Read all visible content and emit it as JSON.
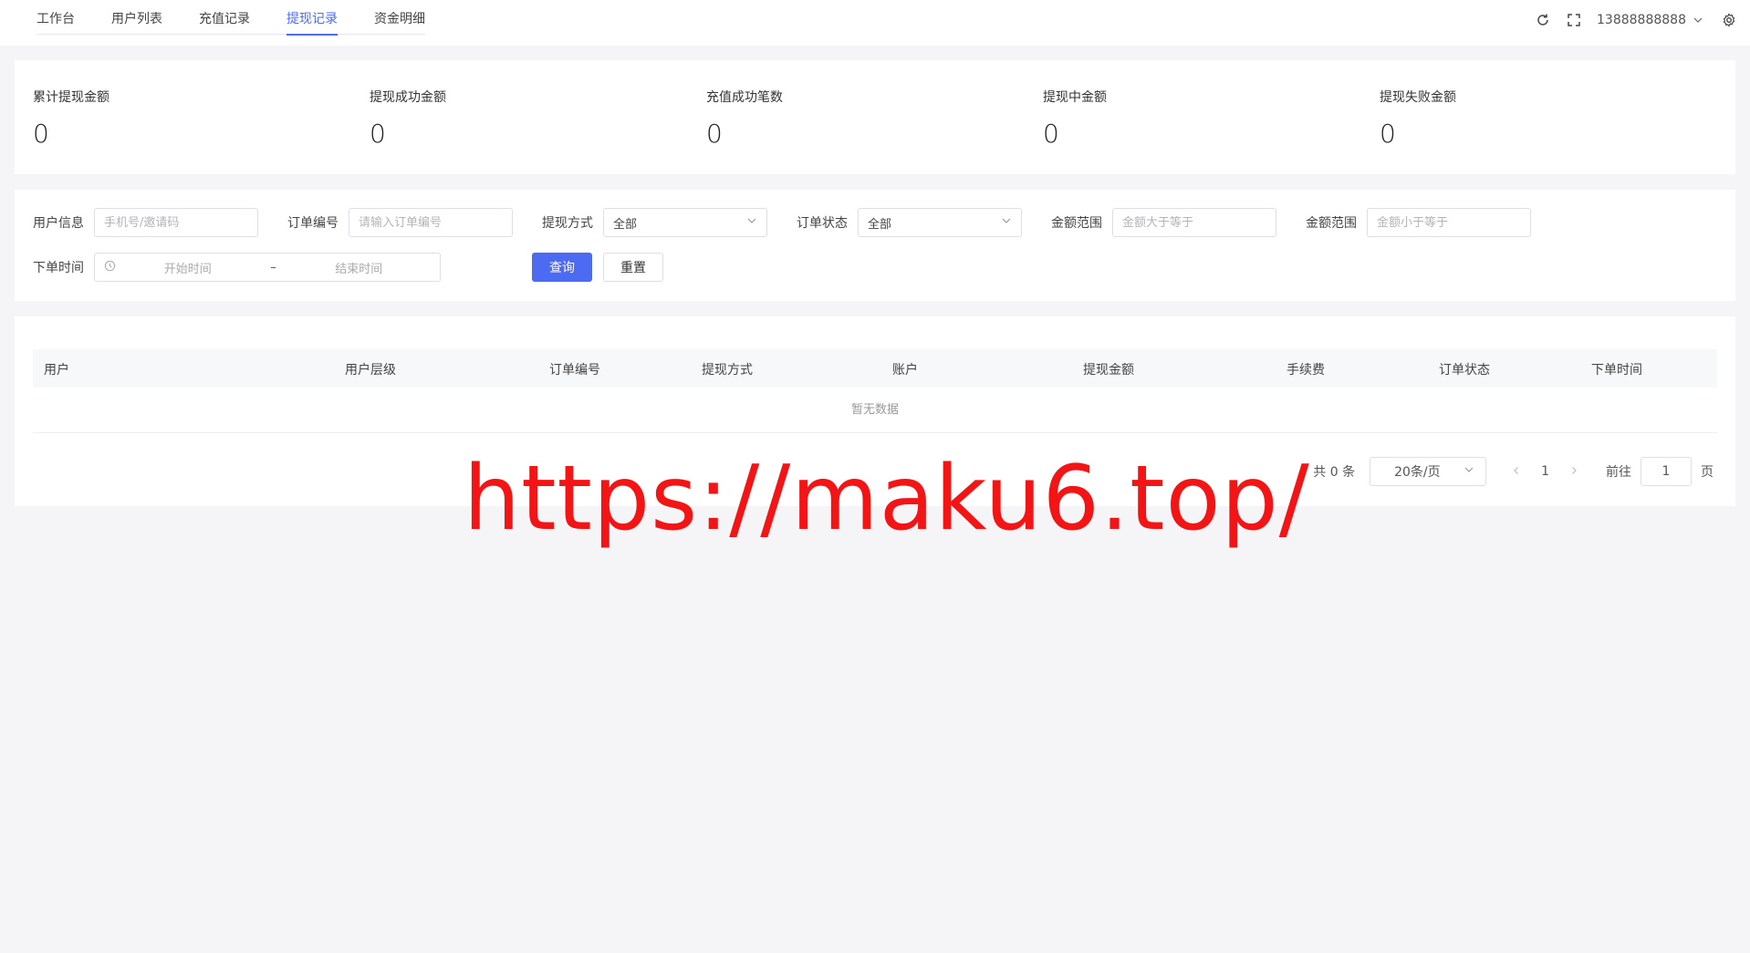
{
  "tabs": [
    {
      "label": "工作台"
    },
    {
      "label": "用户列表"
    },
    {
      "label": "充值记录"
    },
    {
      "label": "提现记录",
      "active": true
    },
    {
      "label": "资金明细"
    }
  ],
  "header": {
    "username": "13888888888",
    "icons": [
      "refresh-icon",
      "fullscreen-icon",
      "chevron-down-icon",
      "gear-icon"
    ]
  },
  "stats": [
    {
      "label": "累计提现金额",
      "value": "0"
    },
    {
      "label": "提现成功金额",
      "value": "0"
    },
    {
      "label": "充值成功笔数",
      "value": "0"
    },
    {
      "label": "提现中金额",
      "value": "0"
    },
    {
      "label": "提现失败金额",
      "value": "0"
    }
  ],
  "filters": {
    "user_info": {
      "label": "用户信息",
      "placeholder": "手机号/邀请码"
    },
    "order_no": {
      "label": "订单编号",
      "placeholder": "请输入订单编号"
    },
    "method": {
      "label": "提现方式",
      "value": "全部"
    },
    "status": {
      "label": "订单状态",
      "value": "全部"
    },
    "amount_min": {
      "label": "金额范围",
      "placeholder": "金额大于等于"
    },
    "amount_max": {
      "label": "金额范围",
      "placeholder": "金额小于等于"
    },
    "order_time": {
      "label": "下单时间",
      "start_placeholder": "开始时间",
      "separator": "–",
      "end_placeholder": "结束时间"
    },
    "query_label": "查询",
    "reset_label": "重置"
  },
  "table": {
    "columns": [
      "用户",
      "用户层级",
      "订单编号",
      "提现方式",
      "账户",
      "提现金额",
      "手续费",
      "订单状态",
      "下单时间"
    ],
    "empty_text": "暂无数据"
  },
  "pagination": {
    "total_text": "共 0 条",
    "page_size": "20条/页",
    "current_page": "1",
    "goto_label": "前往",
    "goto_value": "1",
    "page_suffix": "页"
  },
  "watermark": "https://maku6.top/",
  "colors": {
    "accent": "#4c6af2",
    "watermark": "#f31515",
    "background": "#f5f5f7"
  }
}
